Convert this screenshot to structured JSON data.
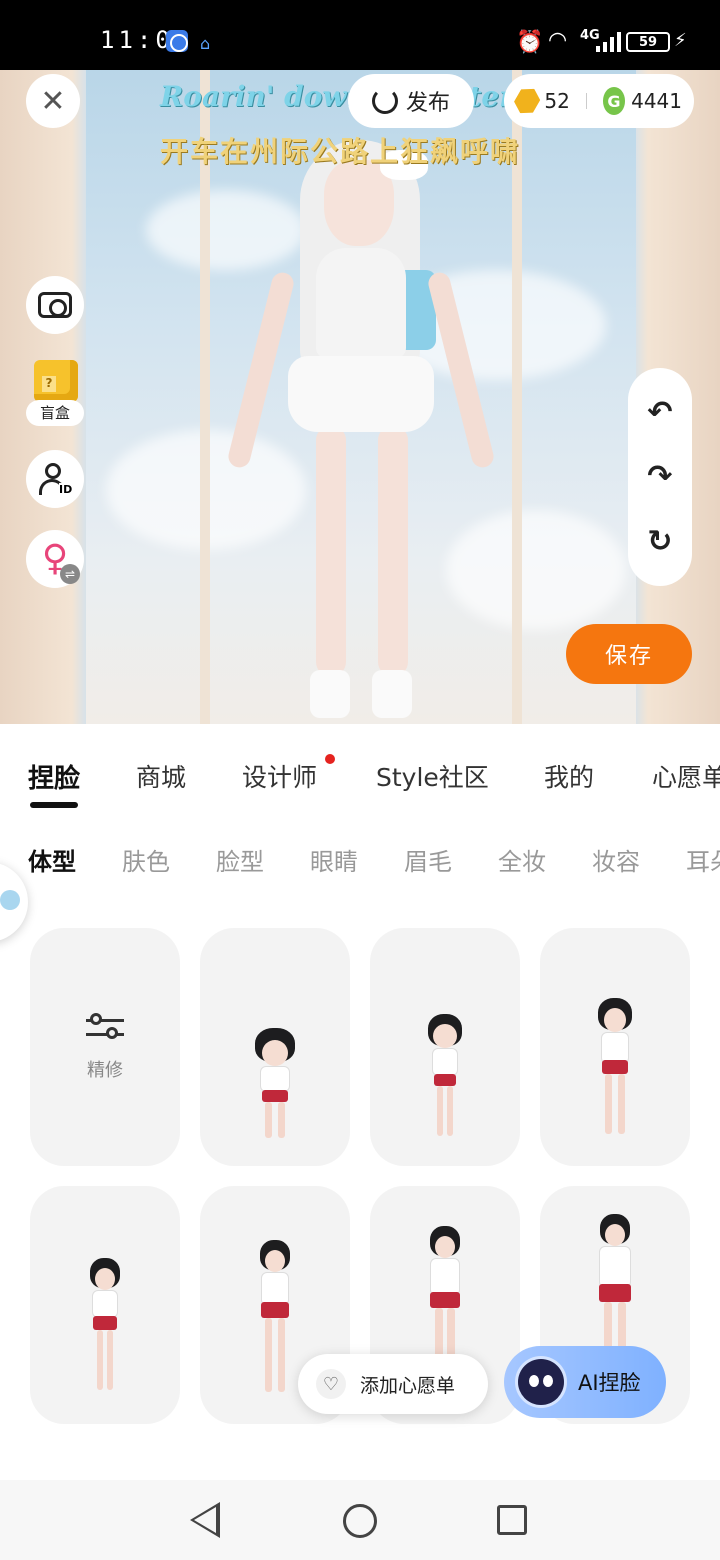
{
  "status_bar": {
    "time": "11:01",
    "network_type": "4G",
    "battery": "59",
    "icons": [
      "browser-globe-icon",
      "home-mini-icon",
      "alarm-icon",
      "wifi-icon",
      "signal-icon",
      "battery-icon",
      "charging-icon"
    ]
  },
  "scene": {
    "lyric_en": "Roarin' down the interstate",
    "lyric_cn": "开车在州际公路上狂飙呼啸"
  },
  "top_bar": {
    "close_icon": "close-icon",
    "publish_label": "发布",
    "gold_coins": "52",
    "green_coins": "4441",
    "green_coin_letter": "G"
  },
  "left_tools": {
    "blindbox_label": "盲盒",
    "blindbox_mark": "?",
    "id_text": "ID",
    "gender_symbol": "♀",
    "swap_symbol": "⇌"
  },
  "right_tools": {
    "undo": "↶",
    "redo": "↷",
    "reset": "↻"
  },
  "save_label": "保存",
  "main_tabs": [
    {
      "label": "捏脸",
      "active": true
    },
    {
      "label": "商城"
    },
    {
      "label": "设计师",
      "badge": true
    },
    {
      "label": "Style社区"
    },
    {
      "label": "我的"
    },
    {
      "label": "心愿单"
    }
  ],
  "sub_tabs": [
    {
      "label": "体型",
      "active": true
    },
    {
      "label": "肤色"
    },
    {
      "label": "脸型"
    },
    {
      "label": "眼睛"
    },
    {
      "label": "眉毛"
    },
    {
      "label": "全妆"
    },
    {
      "label": "妆容"
    },
    {
      "label": "耳朵"
    }
  ],
  "grid": {
    "refine_label": "精修",
    "items": 7
  },
  "wishlist_button": "添加心愿单",
  "ai_button": "AI捏脸",
  "colors": {
    "accent_orange": "#f5760f",
    "ai_blue": "#7fb1ff",
    "badge_red": "#e5231f",
    "gender_pink": "#e8457a"
  }
}
